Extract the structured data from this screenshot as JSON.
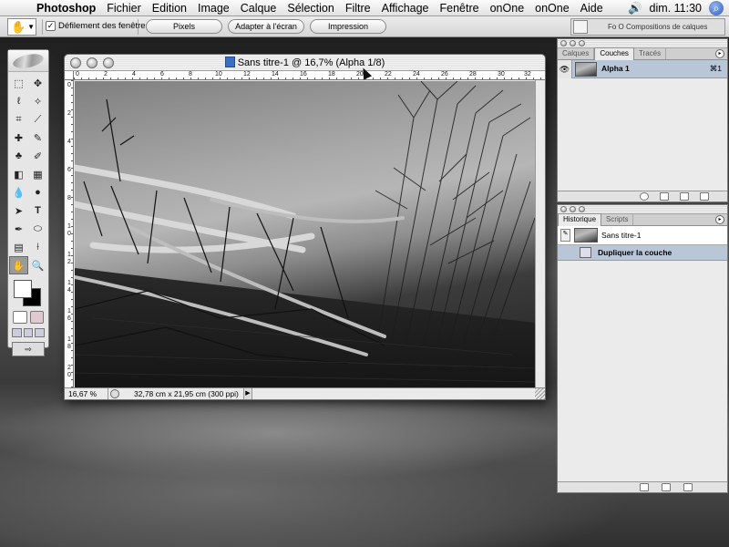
{
  "menubar": {
    "app_name": "Photoshop",
    "items": [
      "Fichier",
      "Edition",
      "Image",
      "Calque",
      "Sélection",
      "Filtre",
      "Affichage",
      "Fenêtre",
      "onOne",
      "onOne",
      "Aide"
    ],
    "clock": "dim. 11:30"
  },
  "options_bar": {
    "scroll_all_windows_label": "Défilement des fenêtres",
    "scroll_all_checked": true,
    "buttons": [
      "Pixels",
      "Adapter à l'écran",
      "Impression"
    ],
    "palette_well_tabs": "Fo  O  Compositions de calques"
  },
  "toolbox": {
    "tools": [
      "marquee",
      "move",
      "lasso",
      "magic-wand",
      "crop",
      "slice",
      "healing",
      "brush",
      "stamp",
      "history-brush",
      "eraser",
      "gradient",
      "blur",
      "dodge",
      "path-select",
      "type",
      "pen",
      "shape",
      "notes",
      "eyedropper",
      "hand",
      "zoom"
    ],
    "selected_tool": "hand"
  },
  "document": {
    "title": "Sans titre-1 @ 16,7% (Alpha 1/8)",
    "zoom": "16,67 %",
    "info": "32,78 cm x 21,95 cm (300 ppi)",
    "ruler_h": [
      "0",
      "2",
      "4",
      "6",
      "8",
      "10",
      "12",
      "14",
      "16",
      "18",
      "20",
      "22",
      "24",
      "26",
      "28",
      "30",
      "32"
    ],
    "ruler_v": [
      "0",
      "2",
      "4",
      "6",
      "8",
      "1 0",
      "1 2",
      "1 4",
      "1 6",
      "1 8",
      "2 0"
    ]
  },
  "channels_palette": {
    "tabs": [
      "Calques",
      "Couches",
      "Tracés"
    ],
    "active_tab": "Couches",
    "channel_name": "Alpha 1",
    "channel_shortcut": "⌘1"
  },
  "history_palette": {
    "tabs": [
      "Historique",
      "Scripts"
    ],
    "active_tab": "Historique",
    "snapshot": "Sans titre-1",
    "step": "Dupliquer la couche"
  }
}
